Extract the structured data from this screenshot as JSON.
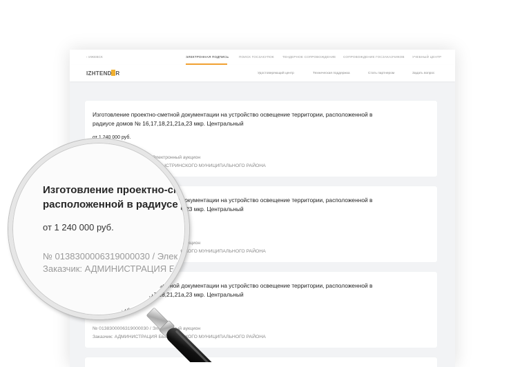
{
  "topbar": {
    "city": "‹ ИЖЕВСК",
    "tabs": [
      {
        "label": "ЭЛЕКТРОННАЯ ПОДПИСЬ",
        "active": true
      },
      {
        "label": "ПОИСК ГОСЗАКУПОК"
      },
      {
        "label": "ТЕНДЕРНОЕ СОПРОВОЖДЕНИЕ"
      },
      {
        "label": "СОПРОВОЖДЕНИЕ ГОСЗАКАЗЧИКОВ"
      },
      {
        "label": "УЧЕБНЫЙ ЦЕНТР"
      }
    ]
  },
  "header": {
    "logo": "IZHTENDER",
    "links": [
      "Удостоверяющий центр",
      "Техническая поддержка",
      "Стать партнером",
      "Задать вопрос"
    ]
  },
  "cards": [
    {
      "title": "Изготовление проектно-сметной документации на устройство освещение территории, расположенной в радиусе домов № 16,17,18,21,21а,23 мкр. Центральный",
      "price": "от 1 240 000 руб.",
      "number": "№ 0138300006319000030 / Электронный аукцион",
      "customer": "Заказчик: АДМИНИСТРАЦИЯ БЫСТРИНСКОГО МУНИЦИПАЛЬНОГО РАЙОНА"
    },
    {
      "title": "Изготовление проектно-сметной документации на устройство освещение территории, расположенной в радиусе домов № 16,17,18,21,21а,23 мкр. Центральный",
      "price": "от 1 240 000 руб.",
      "number": "№ 0138300006319000030 / Электронный аукцион",
      "customer": "Заказчик: АДМИНИСТРАЦИЯ БЫСТРИНСКОГО МУНИЦИПАЛЬНОГО РАЙОНА"
    },
    {
      "title": "Изготовление проектно-сметной документации на устройство освещение территории, расположенной в радиусе домов № 16,17,18,21,21а,23 мкр. Центральный",
      "price": "от 1 240 000 руб.",
      "number": "№ 0138300006319000030 / Электронный аукцион",
      "customer": "Заказчик: АДМИНИСТРАЦИЯ БЫСТРИНСКОГО МУНИЦИПАЛЬНОГО РАЙОНА"
    }
  ],
  "magnified": {
    "title_line1": "Изготовление проектно-см",
    "title_line2": "расположенной в радиусе д",
    "price": "от 1 240 000 руб.",
    "number": "№ 0138300006319000030 / Элек",
    "customer": "Заказчик: АДМИНИСТРАЦИЯ Б"
  },
  "colors": {
    "accent": "#f0a030"
  }
}
